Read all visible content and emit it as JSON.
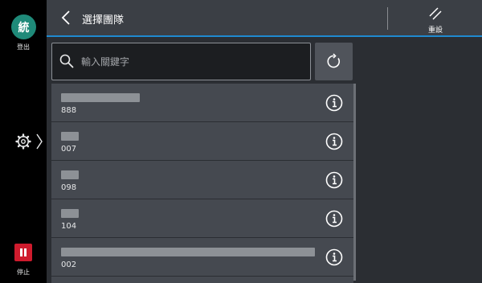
{
  "sidebar": {
    "avatar_text": "統",
    "logout_label": "登出",
    "stop_label": "停止",
    "stop_color": "#cf1b2d",
    "avatar_color": "#1f8a79"
  },
  "header": {
    "title": "選擇團隊",
    "reset_label": "重設",
    "accent_color": "#1f8ad0"
  },
  "search": {
    "placeholder": "輸入關鍵字",
    "value": ""
  },
  "teams": [
    {
      "id": "888"
    },
    {
      "id": "007"
    },
    {
      "id": "098"
    },
    {
      "id": "104"
    },
    {
      "id": "002"
    }
  ]
}
